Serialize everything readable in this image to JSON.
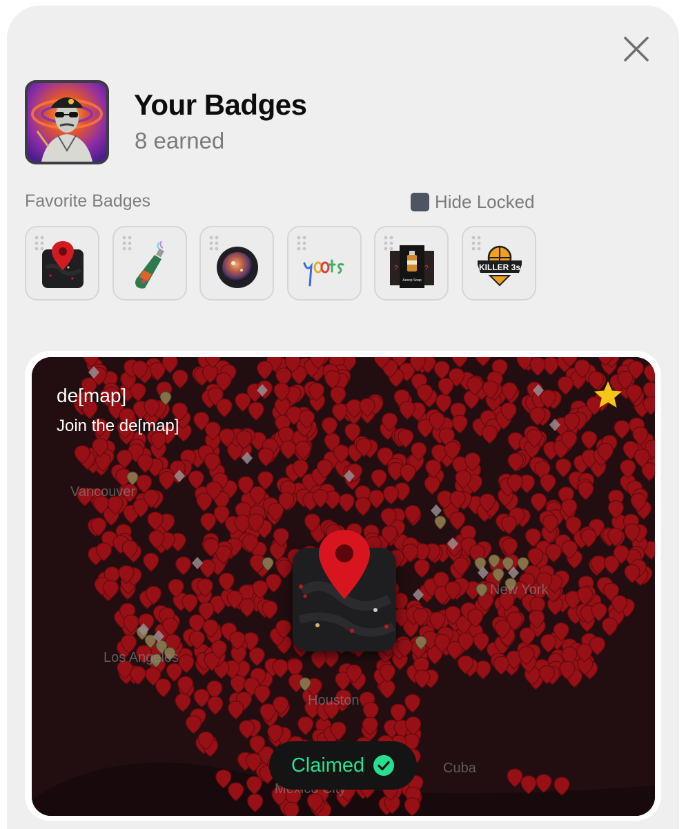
{
  "header": {
    "title": "Your Badges",
    "subtitle": "8 earned"
  },
  "favorites": {
    "label": "Favorite Badges",
    "hide_locked_label": "Hide Locked",
    "items": [
      {
        "name": "demap-badge",
        "icon": "map-pin-icon"
      },
      {
        "name": "bottle-badge",
        "icon": "bottle-icon"
      },
      {
        "name": "orb-badge",
        "icon": "orb-icon"
      },
      {
        "name": "yoots-badge",
        "icon": "yoots-logo",
        "text": "y00ts"
      },
      {
        "name": "aesop-badge",
        "icon": "aesop-cards-icon",
        "text": "Aesop Soap"
      },
      {
        "name": "killer3s-badge",
        "icon": "basketball-logo",
        "text": "KILLER 3s"
      }
    ]
  },
  "featured": {
    "title": "de[map]",
    "description": "Join the de[map]",
    "status": "Claimed",
    "map_labels": [
      "Vancouver",
      "Los Angeles",
      "Houston",
      "New York",
      "Cuba",
      "Mexico City"
    ]
  },
  "colors": {
    "accent_green": "#27e08f",
    "pin_red": "#c4161c",
    "star_yellow": "#f5c518"
  }
}
